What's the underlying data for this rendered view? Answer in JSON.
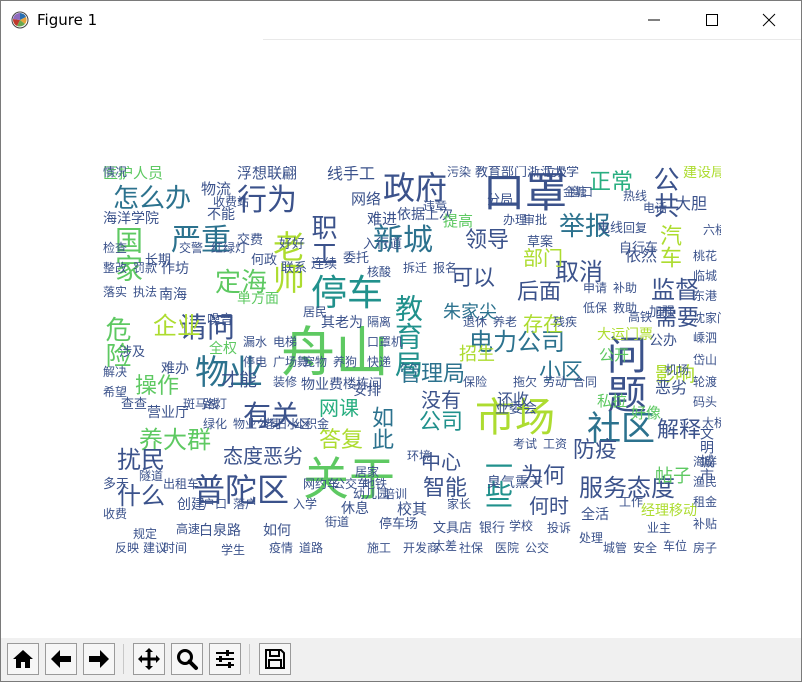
{
  "window": {
    "title": "Figure 1",
    "icons": {
      "app": "matplotlib-logo-icon",
      "minimize": "minimize-icon",
      "maximize": "maximize-icon",
      "close": "close-icon"
    }
  },
  "toolbar": {
    "buttons": [
      {
        "name": "home-button",
        "icon": "home-icon"
      },
      {
        "name": "back-button",
        "icon": "arrow-left-icon"
      },
      {
        "name": "forward-button",
        "icon": "arrow-right-icon"
      },
      {
        "name": "pan-button",
        "icon": "move-arrows-icon"
      },
      {
        "name": "zoom-button",
        "icon": "magnifier-icon"
      },
      {
        "name": "configure-subplots-button",
        "icon": "sliders-icon"
      },
      {
        "name": "save-button",
        "icon": "floppy-disk-icon"
      }
    ]
  },
  "colors": {
    "palette": [
      "#440154",
      "#3b528b",
      "#2c728e",
      "#21918c",
      "#28ae80",
      "#5ec962",
      "#addc30",
      "#c8d43a"
    ]
  },
  "wordcloud": {
    "words": [
      {
        "text": "舟山",
        "color": "#5ec962"
      },
      {
        "text": "市场",
        "color": "#addc30"
      },
      {
        "text": "关于",
        "color": "#5ec962"
      },
      {
        "text": "口罩",
        "color": "#3b528b"
      },
      {
        "text": "问题",
        "color": "#3b528b"
      },
      {
        "text": "停车",
        "color": "#21918c"
      },
      {
        "text": "普陀区",
        "color": "#3b528b"
      },
      {
        "text": "物业",
        "color": "#2c728e"
      },
      {
        "text": "老师",
        "color": "#addc30"
      },
      {
        "text": "社区",
        "color": "#2c728e"
      },
      {
        "text": "政府",
        "color": "#3b528b"
      },
      {
        "text": "新城",
        "color": "#2c728e"
      },
      {
        "text": "行为",
        "color": "#3b528b"
      },
      {
        "text": "严重",
        "color": "#2c728e"
      },
      {
        "text": "请问",
        "color": "#3b528b"
      },
      {
        "text": "有关",
        "color": "#3b528b"
      },
      {
        "text": "教育局",
        "color": "#21918c"
      },
      {
        "text": "电力公司",
        "color": "#2c728e"
      },
      {
        "text": "服务态度",
        "color": "#3b528b"
      },
      {
        "text": "怎么办",
        "color": "#2c728e"
      },
      {
        "text": "举报",
        "color": "#2c728e"
      },
      {
        "text": "公共",
        "color": "#3b528b"
      },
      {
        "text": "定海",
        "color": "#5ec962"
      },
      {
        "text": "养大群",
        "color": "#5ec962"
      },
      {
        "text": "管理局",
        "color": "#2c728e"
      },
      {
        "text": "可以",
        "color": "#3b528b"
      },
      {
        "text": "取消",
        "color": "#3b528b"
      },
      {
        "text": "监督",
        "color": "#3b528b"
      },
      {
        "text": "需要",
        "color": "#3b528b"
      },
      {
        "text": "后面",
        "color": "#3b528b"
      },
      {
        "text": "领导",
        "color": "#3b528b"
      },
      {
        "text": "职工",
        "color": "#3b528b"
      },
      {
        "text": "小区",
        "color": "#2c728e"
      },
      {
        "text": "答复",
        "color": "#addc30"
      },
      {
        "text": "公司",
        "color": "#21918c"
      },
      {
        "text": "防疫",
        "color": "#3b528b"
      },
      {
        "text": "解释",
        "color": "#3b528b"
      },
      {
        "text": "智能",
        "color": "#3b528b"
      },
      {
        "text": "为何",
        "color": "#3b528b"
      },
      {
        "text": "何时",
        "color": "#3b528b"
      },
      {
        "text": "扰民",
        "color": "#3b528b"
      },
      {
        "text": "什么",
        "color": "#3b528b"
      },
      {
        "text": "操作",
        "color": "#5ec962"
      },
      {
        "text": "网课",
        "color": "#28ae80"
      },
      {
        "text": "汽车",
        "color": "#addc30"
      },
      {
        "text": "影响",
        "color": "#addc30"
      },
      {
        "text": "正常",
        "color": "#28ae80"
      },
      {
        "text": "态度恶劣",
        "color": "#3b528b"
      },
      {
        "text": "朱家尖",
        "color": "#2c728e"
      },
      {
        "text": "存在",
        "color": "#addc30"
      },
      {
        "text": "没有",
        "color": "#3b528b"
      },
      {
        "text": "一些",
        "color": "#21918c"
      },
      {
        "text": "中心",
        "color": "#3b528b"
      },
      {
        "text": "部门",
        "color": "#addc30"
      },
      {
        "text": "才能",
        "color": "#3b528b"
      },
      {
        "text": "危险",
        "color": "#5ec962"
      },
      {
        "text": "企业",
        "color": "#addc30"
      },
      {
        "text": "国家",
        "color": "#5ec962"
      },
      {
        "text": "如此",
        "color": "#2c728e"
      },
      {
        "text": "还收",
        "color": "#3b528b"
      },
      {
        "text": "招生",
        "color": "#addc30"
      },
      {
        "text": "帖子",
        "color": "#5ec962"
      },
      {
        "text": "依然",
        "color": "#3b528b"
      },
      {
        "text": "恶劣",
        "color": "#3b528b"
      },
      {
        "text": "大胆",
        "color": "#3b528b"
      },
      {
        "text": "建设局",
        "color": "#addc30"
      },
      {
        "text": "线手工",
        "color": "#3b528b"
      },
      {
        "text": "浮想联翩",
        "color": "#3b528b"
      },
      {
        "text": "医护人员",
        "color": "#5ec962"
      },
      {
        "text": "物流",
        "color": "#3b528b"
      },
      {
        "text": "不能",
        "color": "#3b528b"
      },
      {
        "text": "难进",
        "color": "#3b528b"
      },
      {
        "text": "网络",
        "color": "#3b528b"
      },
      {
        "text": "依据上次",
        "color": "#3b528b"
      },
      {
        "text": "提高",
        "color": "#5ec962"
      },
      {
        "text": "分局",
        "color": "#3b528b"
      },
      {
        "text": "作坊",
        "color": "#3b528b"
      },
      {
        "text": "南海",
        "color": "#3b528b"
      },
      {
        "text": "单方面",
        "color": "#5ec962"
      },
      {
        "text": "其老为",
        "color": "#3b528b"
      },
      {
        "text": "全权",
        "color": "#5ec962"
      },
      {
        "text": "难办",
        "color": "#3b528b"
      },
      {
        "text": "营业厅",
        "color": "#3b528b"
      },
      {
        "text": "物业费",
        "color": "#3b528b"
      },
      {
        "text": "安排",
        "color": "#3b528b"
      },
      {
        "text": "业委会",
        "color": "#3b528b"
      },
      {
        "text": "臭气熏天",
        "color": "#3b528b"
      },
      {
        "text": "公开",
        "color": "#5ec962"
      },
      {
        "text": "私拉",
        "color": "#5ec962"
      },
      {
        "text": "好像",
        "color": "#5ec962"
      },
      {
        "text": "公办",
        "color": "#3b528b"
      },
      {
        "text": "大运门票",
        "color": "#addc30"
      },
      {
        "text": "文明城市",
        "color": "#3b528b"
      },
      {
        "text": "经理移动",
        "color": "#addc30"
      },
      {
        "text": "全活",
        "color": "#3b528b"
      },
      {
        "text": "校其",
        "color": "#3b528b"
      },
      {
        "text": "休息",
        "color": "#3b528b"
      },
      {
        "text": "停车场",
        "color": "#3b528b"
      },
      {
        "text": "如何",
        "color": "#3b528b"
      },
      {
        "text": "白泉路",
        "color": "#3b528b"
      },
      {
        "text": "创建",
        "color": "#3b528b"
      },
      {
        "text": "多天",
        "color": "#3b528b"
      },
      {
        "text": "涉及",
        "color": "#3b528b"
      },
      {
        "text": "查查",
        "color": "#3b528b"
      },
      {
        "text": "教育部门",
        "color": "#3b528b"
      },
      {
        "text": "浙江大学",
        "color": "#3b528b"
      },
      {
        "text": "海洋学院",
        "color": "#3b528b"
      },
      {
        "text": "情况",
        "color": "#3b528b"
      },
      {
        "text": "交费",
        "color": "#3b528b"
      },
      {
        "text": "好好",
        "color": "#3b528b"
      },
      {
        "text": "联系",
        "color": "#3b528b"
      },
      {
        "text": "连续",
        "color": "#3b528b"
      },
      {
        "text": "委托",
        "color": "#3b528b"
      },
      {
        "text": "入行道",
        "color": "#3b528b"
      },
      {
        "text": "电线",
        "color": "#3b528b"
      },
      {
        "text": "自行车",
        "color": "#3b528b"
      },
      {
        "text": "加强",
        "color": "#3b528b"
      },
      {
        "text": "草案",
        "color": "#3b528b"
      },
      {
        "text": "楼栋间",
        "color": "#3b528b"
      },
      {
        "text": "银行",
        "color": "#3b528b"
      },
      {
        "text": "文具店",
        "color": "#3b528b"
      },
      {
        "text": "太差",
        "color": "#3b528b"
      },
      {
        "text": "长期",
        "color": "#3b528b"
      },
      {
        "text": "何政",
        "color": "#3b528b"
      },
      {
        "text": "噪音",
        "color": "#3b528b"
      },
      {
        "text": "居民",
        "color": "#3b528b"
      },
      {
        "text": "街道",
        "color": "#3b528b"
      },
      {
        "text": "居家",
        "color": "#3b528b"
      },
      {
        "text": "环境",
        "color": "#3b528b"
      },
      {
        "text": "家长",
        "color": "#3b528b"
      },
      {
        "text": "学校",
        "color": "#3b528b"
      },
      {
        "text": "投诉",
        "color": "#3b528b"
      },
      {
        "text": "处理",
        "color": "#3b528b"
      },
      {
        "text": "工作",
        "color": "#3b528b"
      },
      {
        "text": "业主",
        "color": "#3b528b"
      },
      {
        "text": "车位",
        "color": "#3b528b"
      },
      {
        "text": "收费",
        "color": "#3b528b"
      },
      {
        "text": "规定",
        "color": "#3b528b"
      },
      {
        "text": "时间",
        "color": "#3b528b"
      },
      {
        "text": "学生",
        "color": "#3b528b"
      },
      {
        "text": "疫情",
        "color": "#3b528b"
      },
      {
        "text": "道路",
        "color": "#3b528b"
      },
      {
        "text": "施工",
        "color": "#3b528b"
      },
      {
        "text": "开发商",
        "color": "#3b528b"
      },
      {
        "text": "社保",
        "color": "#3b528b"
      },
      {
        "text": "医院",
        "color": "#3b528b"
      },
      {
        "text": "公交",
        "color": "#3b528b"
      },
      {
        "text": "城管",
        "color": "#3b528b"
      },
      {
        "text": "安全",
        "color": "#3b528b"
      },
      {
        "text": "房子",
        "color": "#3b528b"
      },
      {
        "text": "补贴",
        "color": "#3b528b"
      },
      {
        "text": "租金",
        "color": "#3b528b"
      },
      {
        "text": "渔民",
        "color": "#3b528b"
      },
      {
        "text": "海鲜",
        "color": "#3b528b"
      },
      {
        "text": "码头",
        "color": "#3b528b"
      },
      {
        "text": "轮渡",
        "color": "#3b528b"
      },
      {
        "text": "岱山",
        "color": "#3b528b"
      },
      {
        "text": "嵊泗",
        "color": "#3b528b"
      },
      {
        "text": "沈家门",
        "color": "#3b528b"
      },
      {
        "text": "东港",
        "color": "#3b528b"
      },
      {
        "text": "临城",
        "color": "#3b528b"
      },
      {
        "text": "桃花",
        "color": "#3b528b"
      },
      {
        "text": "六横",
        "color": "#3b528b"
      },
      {
        "text": "金塘",
        "color": "#3b528b"
      },
      {
        "text": "垃圾",
        "color": "#3b528b"
      },
      {
        "text": "污染",
        "color": "#3b528b"
      },
      {
        "text": "违章",
        "color": "#3b528b"
      },
      {
        "text": "拆迁",
        "color": "#3b528b"
      },
      {
        "text": "报名",
        "color": "#3b528b"
      },
      {
        "text": "核酸",
        "color": "#3b528b"
      },
      {
        "text": "隔离",
        "color": "#3b528b"
      },
      {
        "text": "口罩机",
        "color": "#3b528b"
      },
      {
        "text": "快递",
        "color": "#3b528b"
      },
      {
        "text": "养狗",
        "color": "#3b528b"
      },
      {
        "text": "宠物",
        "color": "#3b528b"
      },
      {
        "text": "广场舞",
        "color": "#3b528b"
      },
      {
        "text": "装修",
        "color": "#3b528b"
      },
      {
        "text": "电梯",
        "color": "#3b528b"
      },
      {
        "text": "漏水",
        "color": "#3b528b"
      },
      {
        "text": "停电",
        "color": "#3b528b"
      },
      {
        "text": "路灯",
        "color": "#3b528b"
      },
      {
        "text": "绿化",
        "color": "#3b528b"
      },
      {
        "text": "物业公司",
        "color": "#3b528b"
      },
      {
        "text": "老旧小区",
        "color": "#3b528b"
      },
      {
        "text": "公积金",
        "color": "#3b528b"
      },
      {
        "text": "户口",
        "color": "#3b528b"
      },
      {
        "text": "落户",
        "color": "#3b528b"
      },
      {
        "text": "入学",
        "color": "#3b528b"
      },
      {
        "text": "幼儿园",
        "color": "#3b528b"
      },
      {
        "text": "培训",
        "color": "#3b528b"
      },
      {
        "text": "考试",
        "color": "#3b528b"
      },
      {
        "text": "工资",
        "color": "#3b528b"
      },
      {
        "text": "拖欠",
        "color": "#3b528b"
      },
      {
        "text": "劳动",
        "color": "#3b528b"
      },
      {
        "text": "合同",
        "color": "#3b528b"
      },
      {
        "text": "保险",
        "color": "#3b528b"
      },
      {
        "text": "退休",
        "color": "#3b528b"
      },
      {
        "text": "养老",
        "color": "#3b528b"
      },
      {
        "text": "残疾",
        "color": "#3b528b"
      },
      {
        "text": "低保",
        "color": "#3b528b"
      },
      {
        "text": "救助",
        "color": "#3b528b"
      },
      {
        "text": "补助",
        "color": "#3b528b"
      },
      {
        "text": "申请",
        "color": "#3b528b"
      },
      {
        "text": "审批",
        "color": "#3b528b"
      },
      {
        "text": "办理",
        "color": "#3b528b"
      },
      {
        "text": "窗口",
        "color": "#3b528b"
      },
      {
        "text": "热线",
        "color": "#3b528b"
      },
      {
        "text": "电话",
        "color": "#3b528b"
      },
      {
        "text": "回复",
        "color": "#3b528b"
      },
      {
        "text": "反映",
        "color": "#3b528b"
      },
      {
        "text": "建议",
        "color": "#3b528b"
      },
      {
        "text": "希望",
        "color": "#3b528b"
      },
      {
        "text": "解决",
        "color": "#3b528b"
      },
      {
        "text": "落实",
        "color": "#3b528b"
      },
      {
        "text": "整改",
        "color": "#3b528b"
      },
      {
        "text": "检查",
        "color": "#3b528b"
      },
      {
        "text": "执法",
        "color": "#3b528b"
      },
      {
        "text": "罚款",
        "color": "#3b528b"
      },
      {
        "text": "交警",
        "color": "#3b528b"
      },
      {
        "text": "红绿灯",
        "color": "#3b528b"
      },
      {
        "text": "斑马线",
        "color": "#3b528b"
      },
      {
        "text": "出租车",
        "color": "#3b528b"
      },
      {
        "text": "网约车",
        "color": "#3b528b"
      },
      {
        "text": "公交车",
        "color": "#3b528b"
      },
      {
        "text": "地铁",
        "color": "#3b528b"
      },
      {
        "text": "高铁",
        "color": "#3b528b"
      },
      {
        "text": "机场",
        "color": "#3b528b"
      },
      {
        "text": "大桥",
        "color": "#3b528b"
      },
      {
        "text": "隧道",
        "color": "#3b528b"
      },
      {
        "text": "高速",
        "color": "#3b528b"
      },
      {
        "text": "收费站",
        "color": "#3b528b"
      }
    ]
  }
}
